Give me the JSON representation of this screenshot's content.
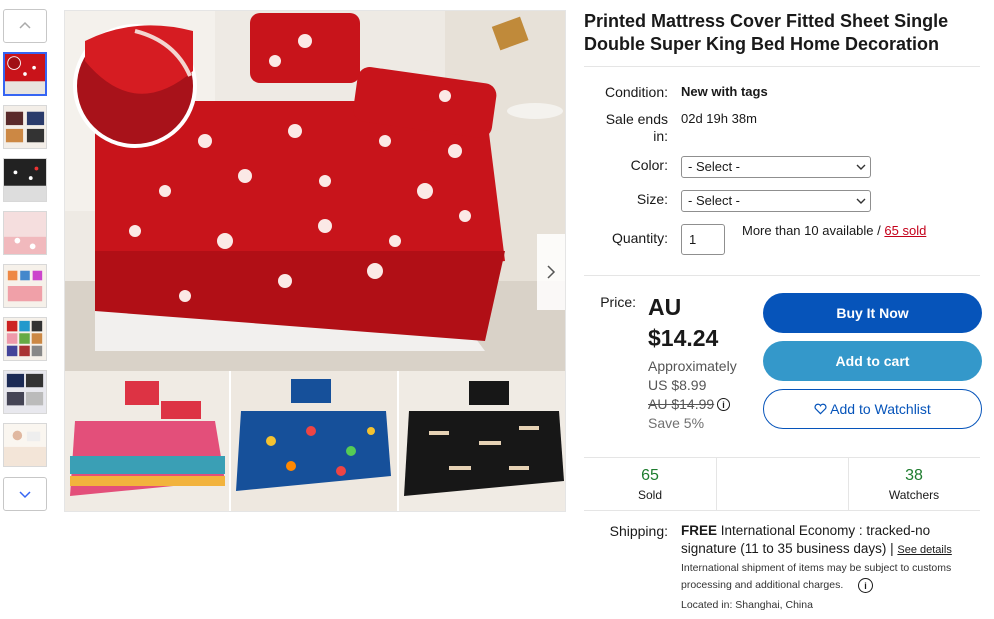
{
  "listing": {
    "title": "Printed Mattress Cover Fitted Sheet Single Double Super King Bed Home Decoration"
  },
  "details": {
    "condition_label": "Condition:",
    "condition_value": "New with tags",
    "sale_ends_label_1": "Sale ends",
    "sale_ends_label_2": "in:",
    "sale_ends_value": "02d 19h 38m",
    "color_label": "Color:",
    "color_selected": "- Select -",
    "size_label": "Size:",
    "size_selected": "- Select -",
    "quantity_label": "Quantity:",
    "quantity_value": "1",
    "availability": "More than 10 available /",
    "sold_link": "65 sold"
  },
  "price": {
    "label": "Price:",
    "currency": "AU",
    "amount": "$14.24",
    "approx_label": "Approximately",
    "approx_value": "US $8.99",
    "was_price": "AU $14.99",
    "savings": "Save 5%"
  },
  "actions": {
    "buy_now": "Buy It Now",
    "add_to_cart": "Add to cart",
    "add_to_watchlist": "Add to Watchlist"
  },
  "stats": {
    "sold_count": "65",
    "sold_label": "Sold",
    "watchers_count": "38",
    "watchers_label": "Watchers"
  },
  "shipping": {
    "label": "Shipping:",
    "free": "FREE",
    "method": "International Economy : tracked-no signature (11 to 35 business days) |",
    "see_details": "See details",
    "note_1": "International shipment of items may be subject to customs",
    "note_2": "processing and additional charges.",
    "location": "Located in: Shanghai, China"
  },
  "colors": {
    "buy_button": "#0654ba",
    "cart_button": "#3498ca",
    "sold_link": "#c4001a",
    "stat_number": "#1d7c2e",
    "selected_thumb": "#3665f3"
  },
  "icons": {
    "rail_up": "chevron-up-icon",
    "rail_down": "chevron-down-icon",
    "image_prev": "chevron-left-icon",
    "image_next": "chevron-right-icon",
    "watchlist": "heart-icon",
    "info": "info-icon"
  }
}
